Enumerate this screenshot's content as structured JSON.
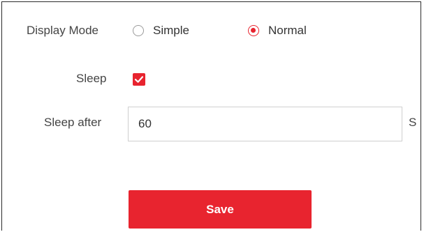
{
  "display_mode": {
    "label": "Display Mode",
    "options": [
      {
        "label": "Simple",
        "checked": false
      },
      {
        "label": "Normal",
        "checked": true
      }
    ]
  },
  "sleep": {
    "label": "Sleep",
    "checked": true
  },
  "sleep_after": {
    "label": "Sleep after",
    "value": "60",
    "unit": "S"
  },
  "actions": {
    "save_label": "Save"
  },
  "colors": {
    "accent": "#e8242f",
    "border": "#2b2b2b",
    "input_border": "#cfcfcf"
  }
}
